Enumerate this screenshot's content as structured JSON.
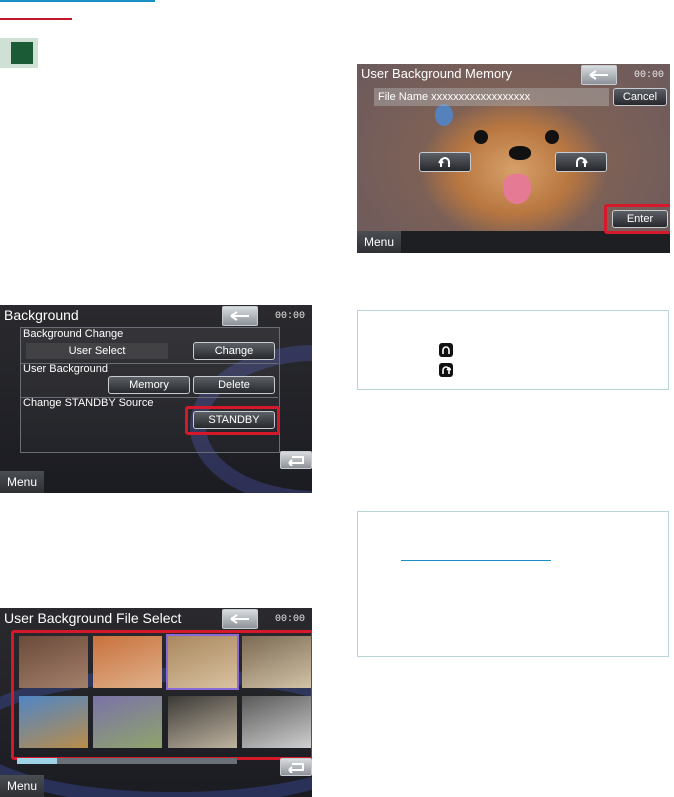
{
  "bg_settings": {
    "title": "Background",
    "clock": "00:00",
    "background_change_label": "Background Change",
    "background_change_value": "User Select",
    "change_button": "Change",
    "user_background_label": "User Background",
    "memory_button": "Memory",
    "delete_button": "Delete",
    "standby_label": "Change STANDBY Source",
    "standby_button": "STANDBY",
    "menu_button": "Menu"
  },
  "memory_screen": {
    "title": "User Background Memory",
    "clock": "00:00",
    "file_name": "File Name xxxxxxxxxxxxxxxxxx",
    "cancel_button": "Cancel",
    "enter_button": "Enter",
    "menu_button": "Menu"
  },
  "file_select": {
    "title": "User Background File Select",
    "clock": "00:00",
    "menu_button": "Menu",
    "thumbnails": [
      {
        "name": "thumb-baby",
        "colors": [
          "#6b4a3a",
          "#a3806b"
        ]
      },
      {
        "name": "thumb-pomeranian-small",
        "colors": [
          "#c8713c",
          "#e0b18b"
        ]
      },
      {
        "name": "thumb-pomeranian-selected",
        "colors": [
          "#a9885e",
          "#d9c1a0"
        ]
      },
      {
        "name": "thumb-dogs-sofa",
        "colors": [
          "#7c6a54",
          "#d1c3a6"
        ]
      },
      {
        "name": "thumb-field",
        "colors": [
          "#4f86c6",
          "#b98c4a"
        ]
      },
      {
        "name": "thumb-lavender",
        "colors": [
          "#7a72a8",
          "#8fa46b"
        ]
      },
      {
        "name": "thumb-bulldog",
        "colors": [
          "#3c3a37",
          "#bfb3a0"
        ]
      },
      {
        "name": "thumb-bridge",
        "colors": [
          "#5a5a5a",
          "#cfcfcf"
        ]
      }
    ]
  },
  "colors": {
    "highlight_red": "#d6182b",
    "note_border": "#b9d5d8",
    "header_blue": "#1a8fc6",
    "header_red": "#c2172c",
    "header_green": "#1b5b35"
  },
  "icons": {
    "back": "left-arrow",
    "return": "return-arrow",
    "rotate_left": "rotate-left",
    "rotate_right": "rotate-right"
  }
}
